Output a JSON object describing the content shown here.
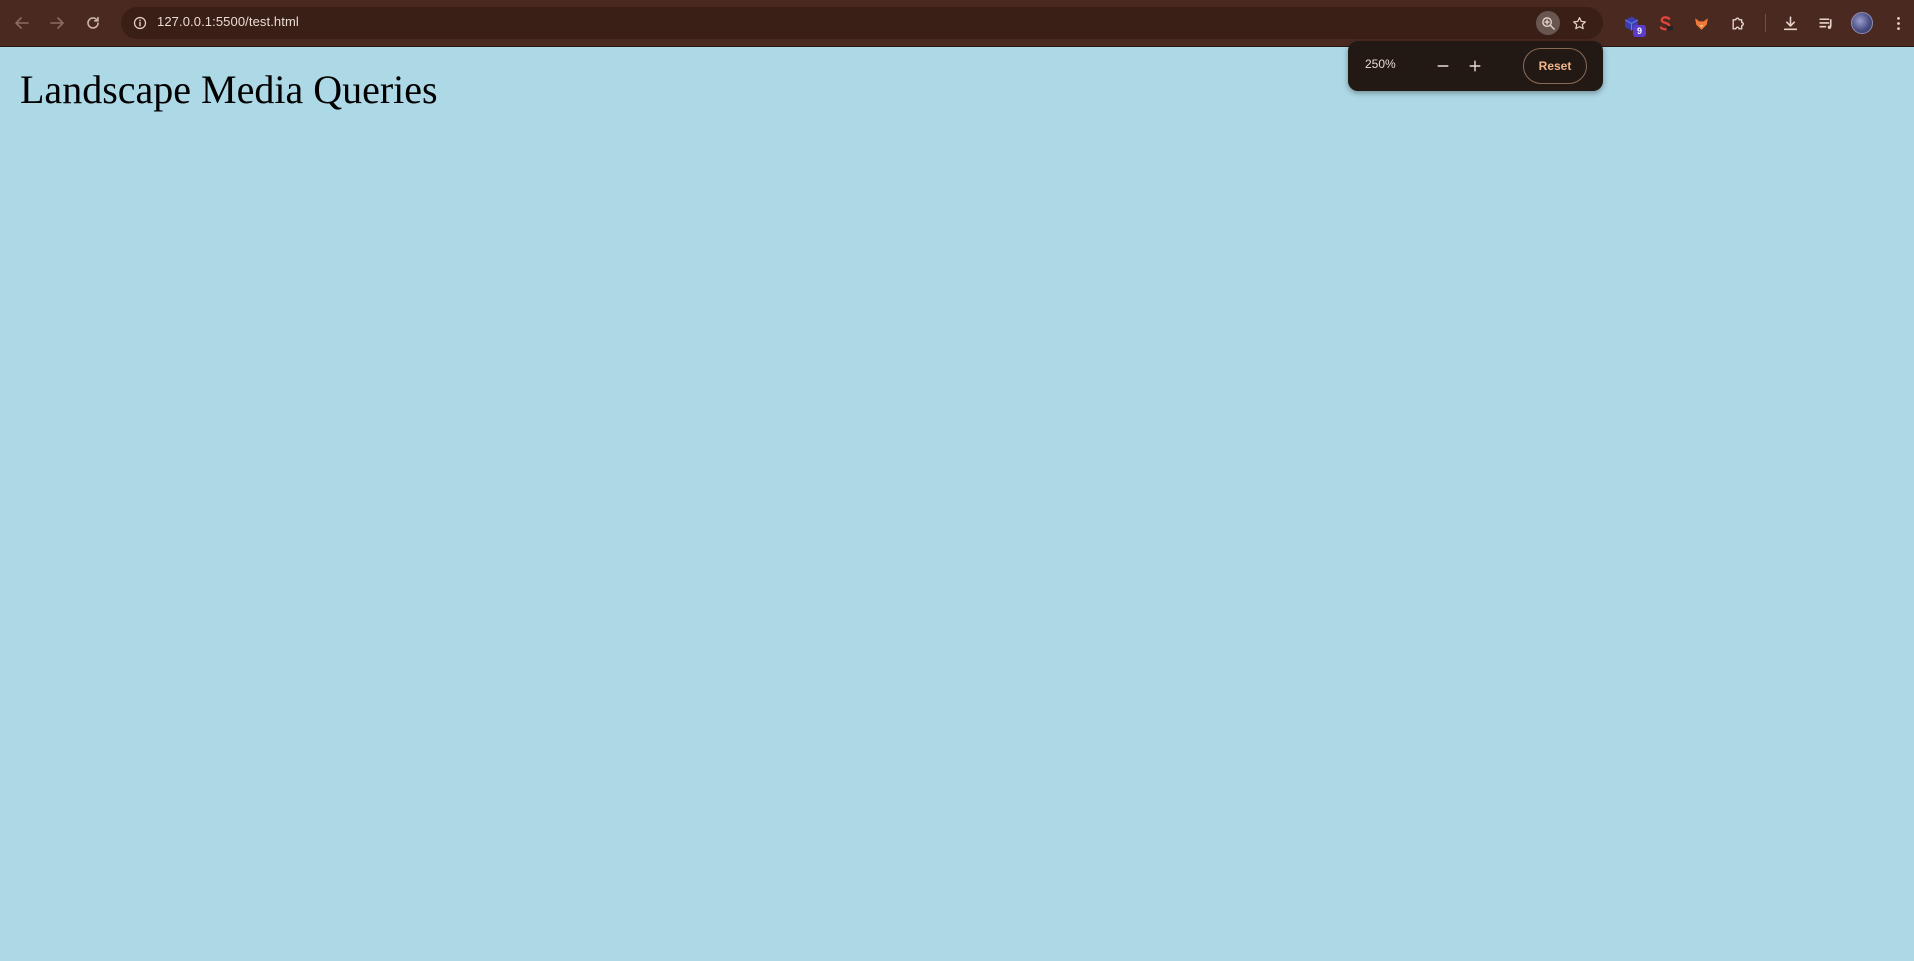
{
  "browser": {
    "url": "127.0.0.1:5500/test.html",
    "extension_badge": "9"
  },
  "page": {
    "title": "Landscape Media Queries",
    "background": "#add8e6"
  },
  "zoom_popup": {
    "level": "250%",
    "reset_label": "Reset"
  },
  "colors": {
    "toolbar": "#4a2a20",
    "omnibox": "#3a1f17",
    "reset_accent": "#f0b48a"
  }
}
